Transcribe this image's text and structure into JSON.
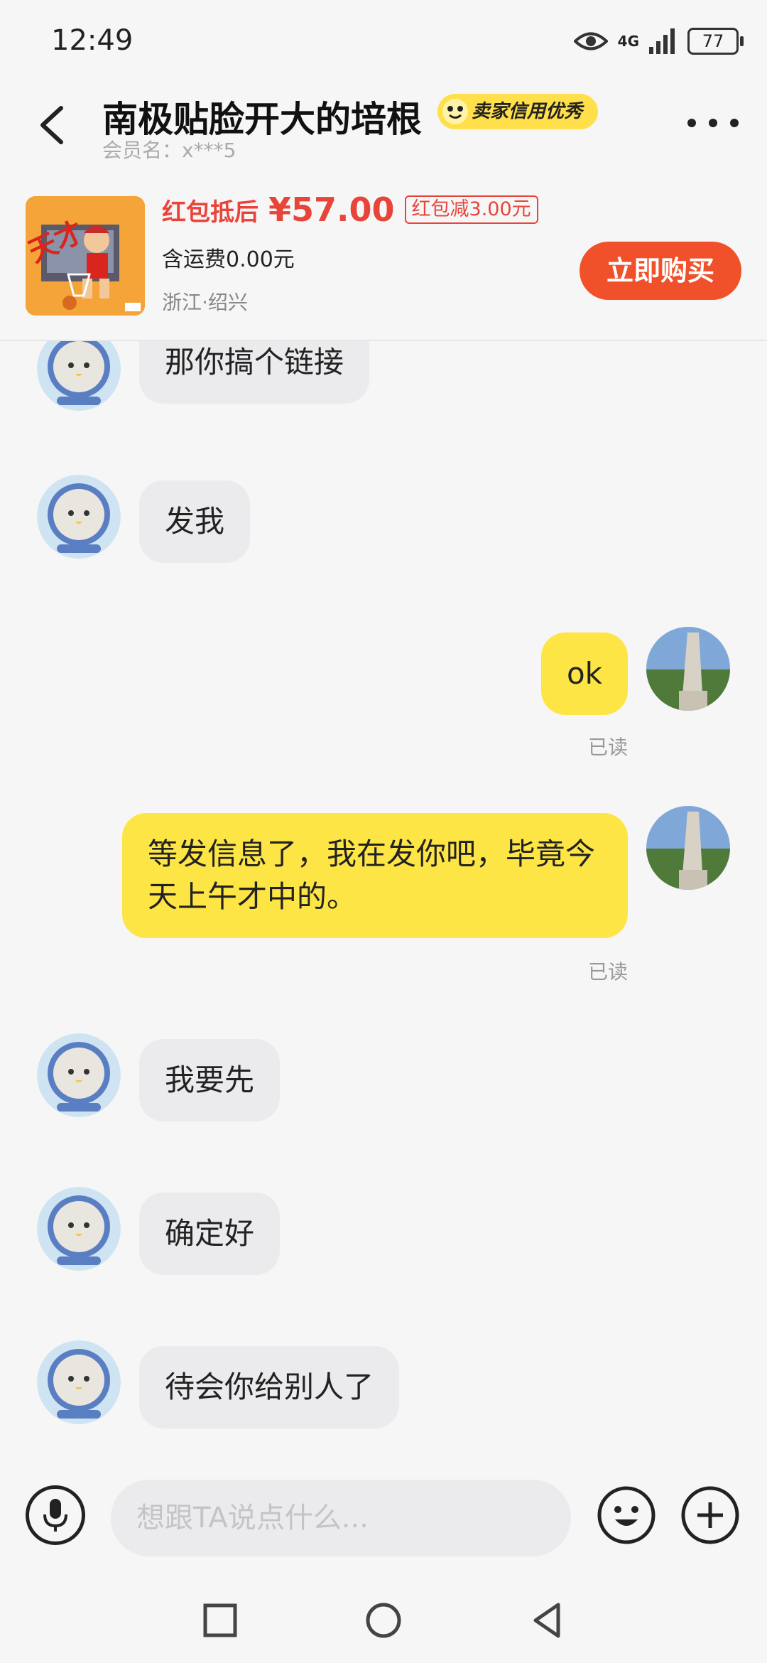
{
  "status": {
    "time": "12:49",
    "network": "4G",
    "battery": "77"
  },
  "header": {
    "back_icon": "chevron-left-icon",
    "title": "南极贴脸开大的培根",
    "credit_badge": "卖家信用优秀",
    "member": "会员名：x***5",
    "more_icon": "more-dots-icon"
  },
  "product": {
    "price_label": "红包抵后",
    "price": "¥57.00",
    "coupon": "红包减3.00元",
    "shipping": "含运费0.00元",
    "location": "浙江·绍兴",
    "buy_label": "立即购买"
  },
  "messages": [
    {
      "side": "left",
      "text": "那你搞个链接"
    },
    {
      "side": "left",
      "text": "发我"
    },
    {
      "side": "right",
      "text": "ok",
      "status": "已读"
    },
    {
      "side": "right",
      "text": "等发信息了，我在发你吧，毕竟今天上午才中的。",
      "status": "已读"
    },
    {
      "side": "left",
      "text": "我要先"
    },
    {
      "side": "left",
      "text": "确定好"
    },
    {
      "side": "left",
      "text": "待会你给别人了"
    }
  ],
  "input": {
    "placeholder": "想跟TA说点什么..."
  },
  "colors": {
    "accent": "#f0512a",
    "price": "#e8443a",
    "bubble_self": "#fde545",
    "bubble_other": "#ebebee"
  }
}
